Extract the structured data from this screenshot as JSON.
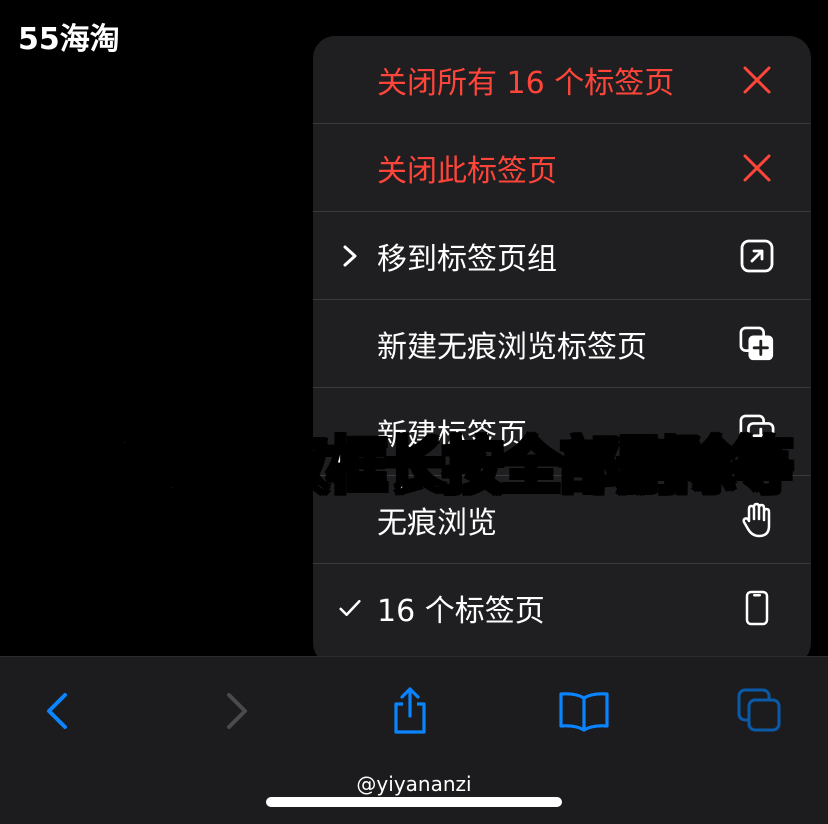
{
  "watermark": {
    "logo_text": "55海淘"
  },
  "menu": {
    "items": [
      {
        "label": "关闭所有 16 个标签页",
        "icon": "close-x-icon",
        "destructive": true,
        "lead": ""
      },
      {
        "label": "关闭此标签页",
        "icon": "close-x-icon",
        "destructive": true,
        "lead": ""
      },
      {
        "label": "移到标签页组",
        "icon": "move-arrow-box-icon",
        "destructive": false,
        "lead": "chevron-right"
      },
      {
        "label": "新建无痕浏览标签页",
        "icon": "new-private-tab-icon",
        "destructive": false,
        "lead": ""
      },
      {
        "label": "新建标签页",
        "icon": "new-tab-icon",
        "destructive": false,
        "lead": ""
      },
      {
        "label": "无痕浏览",
        "icon": "hand-icon",
        "destructive": false,
        "lead": ""
      },
      {
        "label": "16 个标签页",
        "icon": "phone-icon",
        "destructive": false,
        "lead": "checkmark"
      }
    ]
  },
  "overlay": {
    "caption": "网页底部双框长按全部删除等"
  },
  "toolbar": {
    "buttons": [
      "back-icon",
      "forward-icon",
      "share-icon",
      "bookmarks-icon",
      "tabs-icon"
    ]
  },
  "footer": {
    "handle": "@yiyananzi"
  },
  "colors": {
    "accent": "#0a84ff",
    "destructive": "#ff453a",
    "menu_bg": "#1f1f21",
    "toolbar_bg": "#1c1c1e"
  }
}
